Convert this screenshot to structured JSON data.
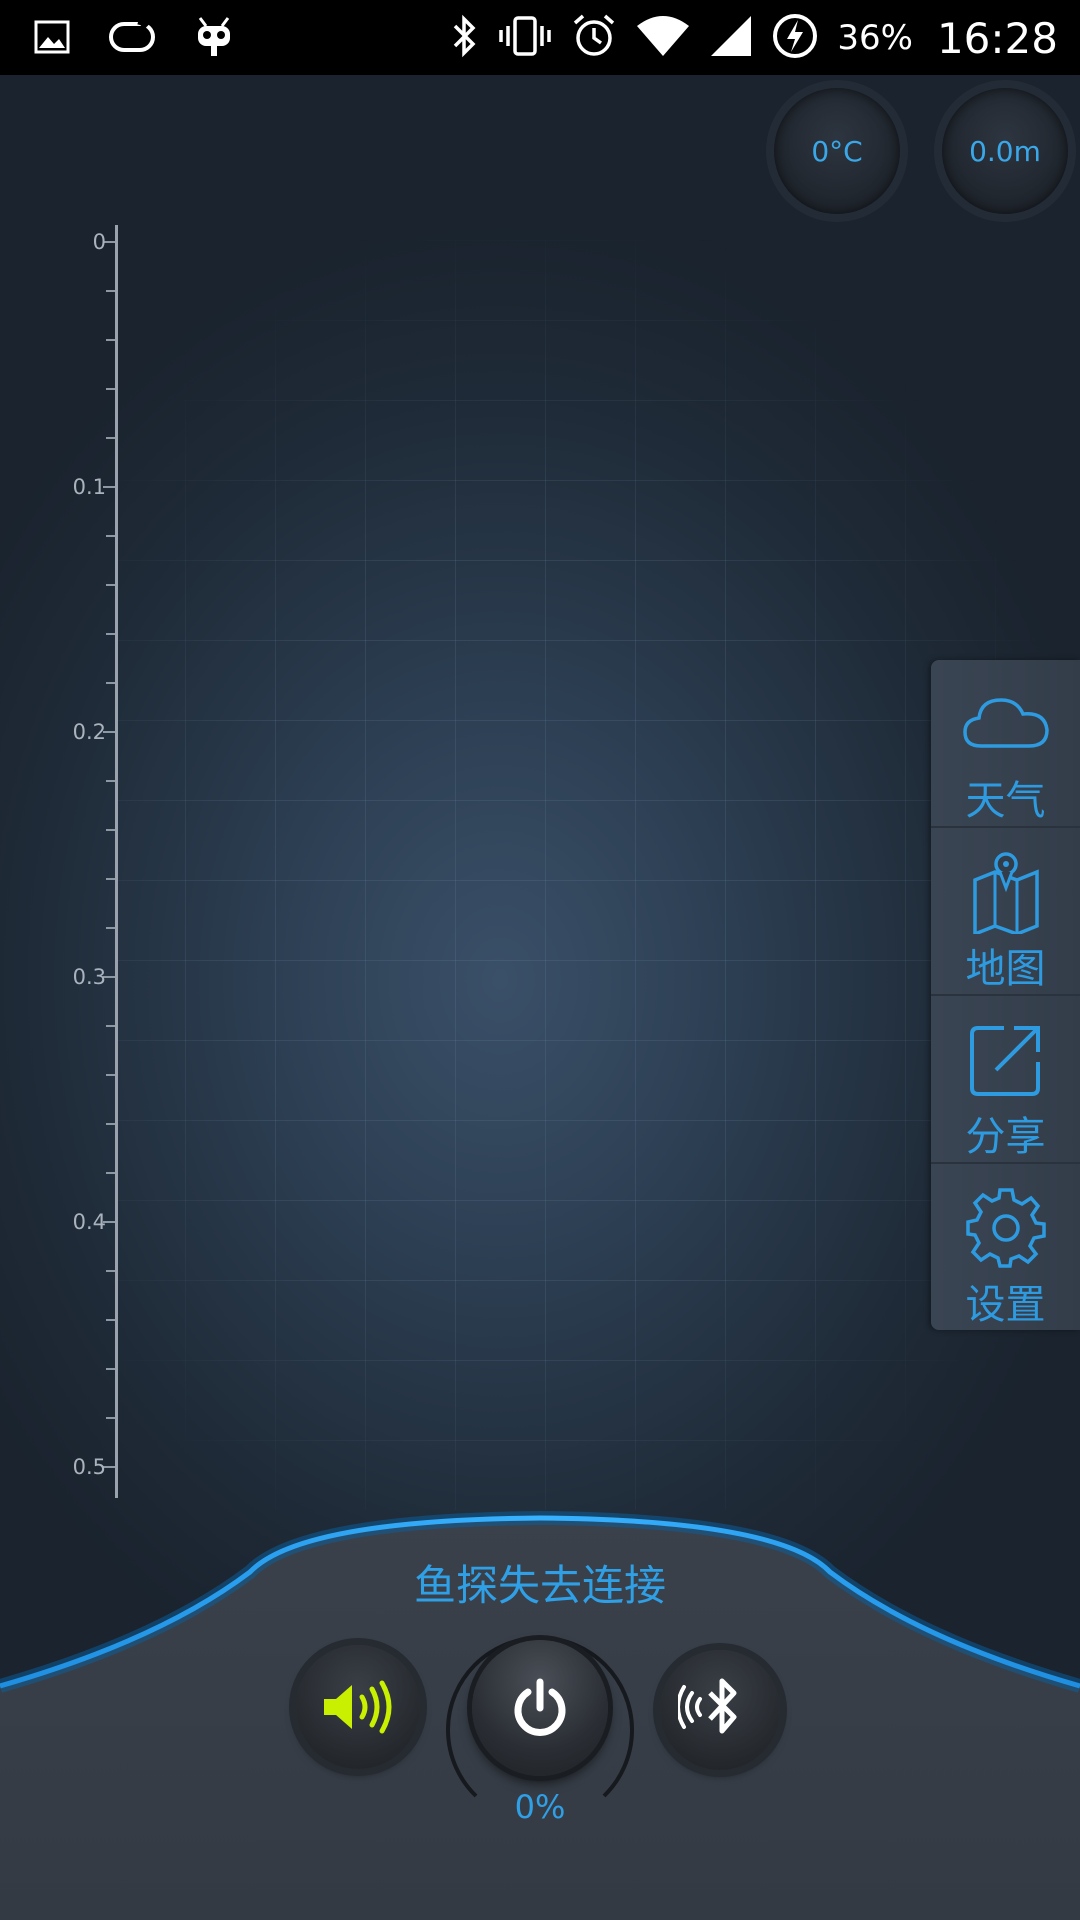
{
  "status_bar": {
    "battery": "36%",
    "time": "16:28",
    "icons": [
      "image-icon",
      "sync-icon",
      "cyanogen-bot-icon",
      "bluetooth-icon",
      "vibrate-icon",
      "alarm-icon",
      "wifi-icon",
      "signal-icon",
      "battery-charging-icon"
    ]
  },
  "gauges": {
    "temperature": "0°C",
    "depth": "0.0m"
  },
  "depth_axis": {
    "labels": [
      "0",
      "0.1",
      "0.2",
      "0.3",
      "0.4",
      "0.5"
    ]
  },
  "side_menu": {
    "items": [
      {
        "label": "天气",
        "icon": "cloud-icon"
      },
      {
        "label": "地图",
        "icon": "map-icon"
      },
      {
        "label": "分享",
        "icon": "share-icon"
      },
      {
        "label": "设置",
        "icon": "gear-icon"
      }
    ]
  },
  "controls": {
    "status": "鱼探失去连接",
    "percent": "0%",
    "accent": "#2f9fe6",
    "sound_color": "#c8f000"
  }
}
